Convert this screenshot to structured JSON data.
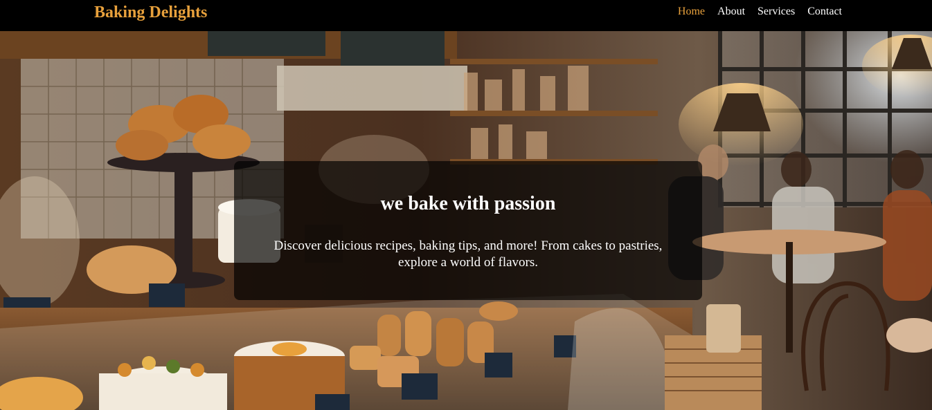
{
  "nav": {
    "brand": "Baking Delights",
    "links": [
      {
        "label": "Home",
        "active": true
      },
      {
        "label": "About",
        "active": false
      },
      {
        "label": "Services",
        "active": false
      },
      {
        "label": "Contact",
        "active": false
      }
    ]
  },
  "hero": {
    "title": "we bake with passion",
    "text": "Discover delicious recipes, baking tips, and more! From cakes to pastries, explore a world of flavors."
  },
  "colors": {
    "accent": "#e8a13c",
    "nav_bg": "#000000",
    "overlay": "rgba(0,0,0,0.68)"
  }
}
